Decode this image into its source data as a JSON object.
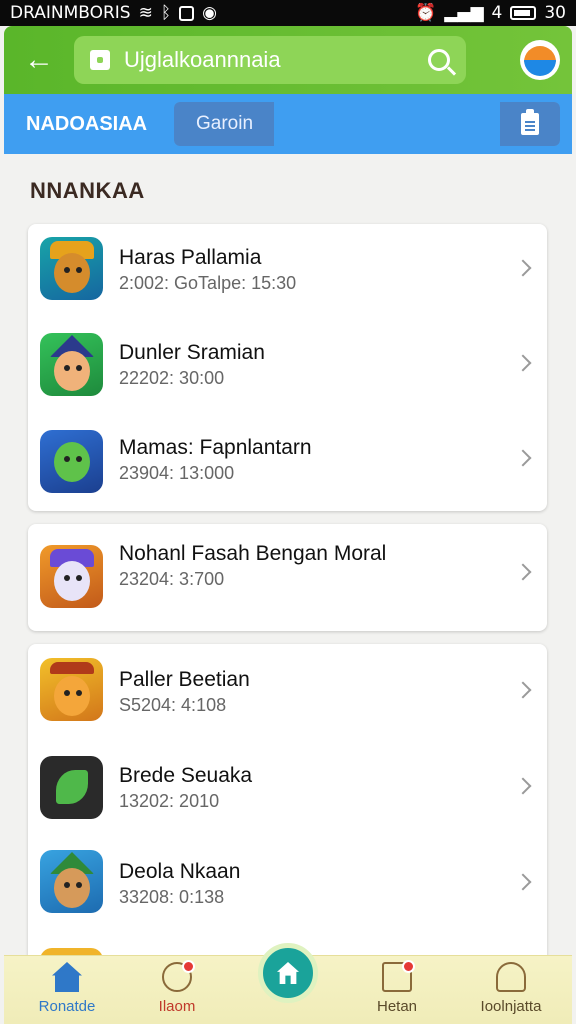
{
  "status_bar": {
    "left_text": "DRAINMBORIS",
    "time": "30",
    "signal": "4"
  },
  "app_bar": {
    "search_text": "Ujglalkoannnaia"
  },
  "tab_bar": {
    "title": "NADOASIAA",
    "tab_label": "Garoin"
  },
  "section": {
    "title": "NNANKAA"
  },
  "groups": [
    {
      "items": [
        {
          "name": "Haras Pallamia",
          "meta": "2:002: GoTalpe: 15:30",
          "icon": "game-icon-warrior"
        },
        {
          "name": "Dunler Sramian",
          "meta": "22202: 30:00",
          "icon": "game-icon-wizard"
        },
        {
          "name": "Mamas: Fapnlantarn",
          "meta": "23904: 13:000",
          "icon": "game-icon-dragon"
        }
      ]
    },
    {
      "items": [
        {
          "name": "Nohanl Fasah Bengan Moral",
          "meta": "23204: 3:700",
          "icon": "game-icon-ghost"
        }
      ]
    },
    {
      "items": [
        {
          "name": "Paller Beetian",
          "meta": "S5204: 4:108",
          "icon": "game-icon-puzzle"
        },
        {
          "name": "Brede Seuaka",
          "meta": "13202: 2010",
          "icon": "game-icon-leaf"
        },
        {
          "name": "Deola Nkaan",
          "meta": "33208: 0:138",
          "icon": "game-icon-archer"
        }
      ]
    }
  ],
  "bottom_nav": [
    {
      "label": "Ronatde",
      "icon": "home-icon",
      "color": "#2f78c8"
    },
    {
      "label": "Ilaom",
      "icon": "ring-icon",
      "color": "#c0392b"
    },
    {
      "label": "Hetan",
      "icon": "box-icon",
      "color": "#8a6a3a"
    },
    {
      "label": "Ioolnjatta",
      "icon": "user-icon",
      "color": "#8a6a3a"
    }
  ]
}
